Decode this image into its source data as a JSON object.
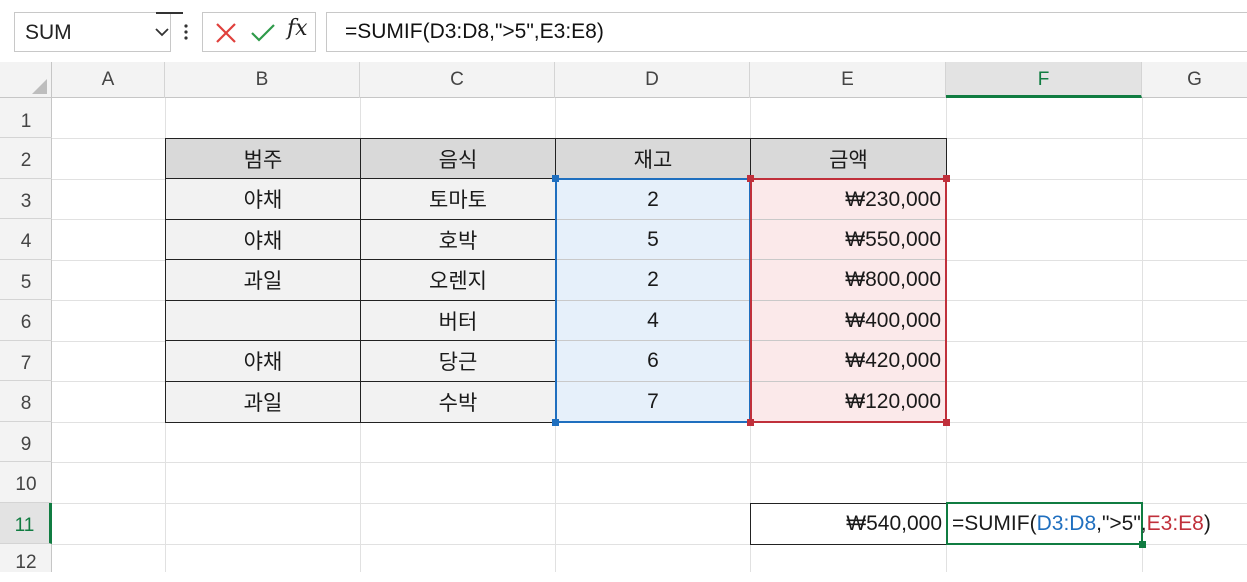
{
  "namebox": {
    "value": "SUM"
  },
  "formula_bar": {
    "cancel_icon": "cancel-x",
    "enter_icon": "check-mark",
    "fx_label": "fx",
    "formula": "=SUMIF(D3:D8,\">5\",E3:E8)"
  },
  "columns": [
    "A",
    "B",
    "C",
    "D",
    "E",
    "F",
    "G"
  ],
  "rows": [
    "1",
    "2",
    "3",
    "4",
    "5",
    "6",
    "7",
    "8",
    "9",
    "10",
    "11",
    "12"
  ],
  "active_cell": {
    "column": "F",
    "row": "11"
  },
  "table": {
    "headers": [
      "범주",
      "음식",
      "재고",
      "금액"
    ],
    "rows": [
      [
        "야채",
        "토마토",
        "2",
        "₩230,000"
      ],
      [
        "야채",
        "호박",
        "5",
        "₩550,000"
      ],
      [
        "과일",
        "오렌지",
        "2",
        "₩800,000"
      ],
      [
        "",
        "버터",
        "4",
        "₩400,000"
      ],
      [
        "야채",
        "당근",
        "6",
        "₩420,000"
      ],
      [
        "과일",
        "수박",
        "7",
        "₩120,000"
      ]
    ]
  },
  "result": {
    "value": "₩540,000"
  },
  "edit_cell": {
    "prefix": "=SUMIF(",
    "range1": "D3:D8",
    "middle": ",\">5\",",
    "range2": "E3:E8",
    "suffix": ")"
  },
  "colors": {
    "accent": "#107c41",
    "range1_border": "#1f6fbf",
    "range1_fill": "#e6f0fa",
    "range2_border": "#c0303b",
    "range2_fill": "#fbe9ea",
    "header_fill": "#d9d9d9",
    "table_fill": "#f2f2f2"
  }
}
